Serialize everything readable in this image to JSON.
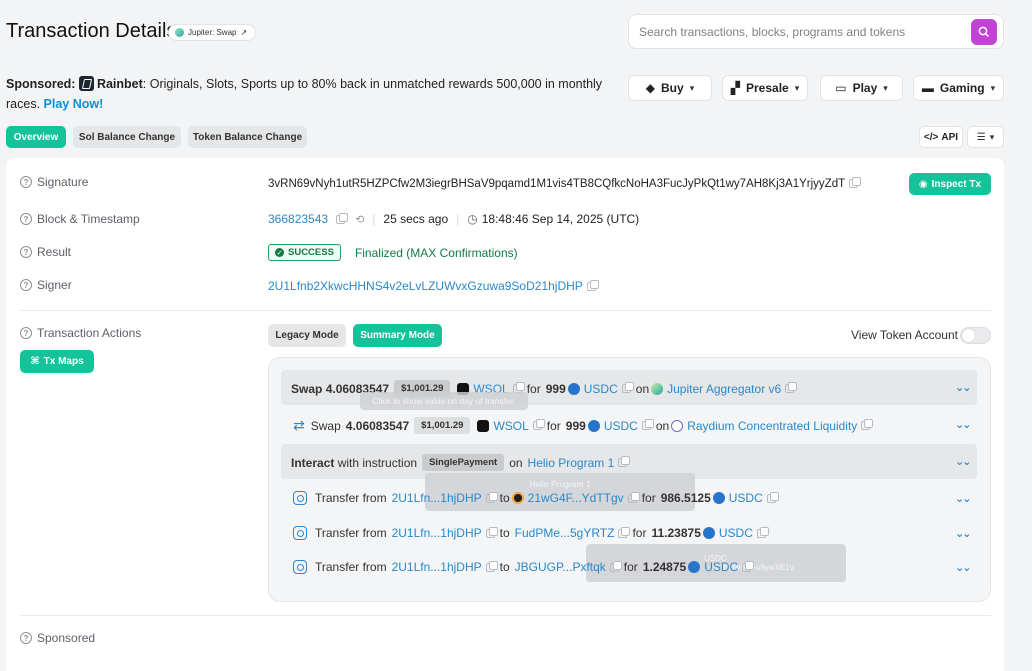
{
  "header": {
    "title": "Transaction Details",
    "program_chip": "Jupiter: Swap",
    "search_placeholder": "Search transactions, blocks, programs and tokens"
  },
  "sponsored": {
    "prefix": "Sponsored:",
    "brand": "Rainbet",
    "text": ": Originals, Slots, Sports up to 80% back in unmatched rewards 500,000 in monthly races.",
    "cta": "Play Now!"
  },
  "nav_buttons": [
    "Buy",
    "Presale",
    "Play",
    "Gaming"
  ],
  "tabs": [
    "Overview",
    "Sol Balance Change",
    "Token Balance Change"
  ],
  "tab_active": "Overview",
  "tools": {
    "api": "API"
  },
  "details": {
    "signature_label": "Signature",
    "signature": "3vRN69vNyh1utR5HZPCfw2M3iegrBHSaV9pqamd1M1vis4TB8CQfkcNoHA3FucJyPkQt1wy7AH8Kj3A1YrjyyZdT",
    "inspect_btn": "Inspect Tx",
    "block_label": "Block & Timestamp",
    "block": "366823543",
    "age": "25 secs ago",
    "timestamp": "18:48:46 Sep 14, 2025 (UTC)",
    "result_label": "Result",
    "result_badge": "SUCCESS",
    "result_text": "Finalized (MAX Confirmations)",
    "signer_label": "Signer",
    "signer": "2U1Lfnb2XkwcHHNS4v2eLvLZUWvxGzuwa9SoD21hjDHP"
  },
  "actions": {
    "label": "Transaction Actions",
    "tx_maps": "Tx Maps",
    "legacy_mode": "Legacy Mode",
    "summary_mode": "Summary Mode",
    "view_token_account": "View Token Account",
    "swap1": {
      "prefix": "Swap",
      "amount": "4.06083547",
      "usd": "$1,001.29",
      "token_in": "WSOL",
      "for": "for",
      "out_amount": "999",
      "token_out": "USDC",
      "on": "on",
      "venue": "Jupiter Aggregator v6"
    },
    "tooltip_swap": "Click to show value on day of transfer.",
    "swap2": {
      "prefix": "Swap",
      "amount": "4.06083547",
      "usd": "$1,001.29",
      "token_in": "WSOL",
      "for": "for",
      "out_amount": "999",
      "token_out": "USDC",
      "on": "on",
      "venue": "Raydium Concentrated Liquidity"
    },
    "interact": {
      "prefix": "Interact",
      "mid": "with instruction",
      "instruction": "SinglePayment",
      "on": "on",
      "program": "Helio Program 1"
    },
    "tooltip_helio": "Helio Program 1",
    "transfers": [
      {
        "label": "Transfer from",
        "from": "2U1Lfn...1hjDHP",
        "to_label": "to",
        "to": "21wG4F...YdTTgv",
        "for": "for",
        "amount": "986.5125",
        "token": "USDC"
      },
      {
        "label": "Transfer from",
        "from": "2U1Lfn...1hjDHP",
        "to_label": "to",
        "to": "FudPMe...5gYRTZ",
        "for": "for",
        "amount": "11.23875",
        "token": "USDC"
      },
      {
        "label": "Transfer from",
        "from": "2U1Lfn...1hjDHP",
        "to_label": "to",
        "to": "JBGUGP...Pxftqk",
        "for": "for",
        "amount": "1.24875",
        "token": "USDC"
      }
    ],
    "tooltip_usdc": "USDC",
    "tooltip_usdc_addr": "...dC8fMwS9Gu8ywXE1v"
  },
  "footer": {
    "sponsored_label": "Sponsored"
  },
  "colors": {
    "accent": "#15c39a",
    "link": "#2a88c9",
    "search_btn": "#c043d6"
  }
}
